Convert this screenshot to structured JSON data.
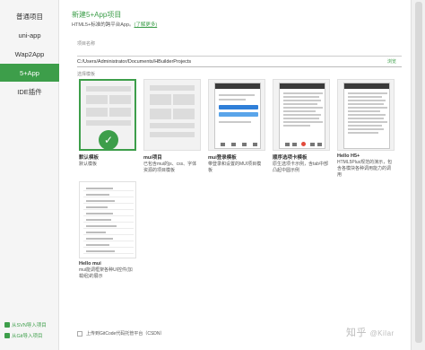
{
  "sidebar": {
    "items": [
      {
        "label": "普通项目"
      },
      {
        "label": "uni-app"
      },
      {
        "label": "Wap2App"
      },
      {
        "label": "5+App"
      },
      {
        "label": "IDE插件"
      }
    ],
    "active_index": 3,
    "footer": [
      {
        "label": "从SVN导入项目"
      },
      {
        "label": "从Git导入项目"
      }
    ]
  },
  "header": {
    "title": "新建5+App项目",
    "subtitle": "HTML5+标准的跨平台App。",
    "subtitle_link": "(了解更多)"
  },
  "form": {
    "name_label": "项目名称",
    "name_value": "",
    "path_value": "C:/Users/Administrator/Documents/HBuilderProjects",
    "browse_label": "浏览",
    "template_label": "选择模板"
  },
  "templates": [
    {
      "name": "默认模板",
      "desc": "默认模板",
      "selected": true
    },
    {
      "name": "mui项目",
      "desc": "已包含mui的js、css、字体资源的项目模板",
      "selected": false
    },
    {
      "name": "mui登录模板",
      "desc": "带登录和设置的MUI项目模板",
      "selected": false
    },
    {
      "name": "顺序选项卡模板",
      "desc": "原生选项卡示例，含tab中部凸起中圆示例",
      "selected": false
    },
    {
      "name": "Hello H5+",
      "desc": "HTML5Plus规范的演示，包含各模块各种调用能力的调用",
      "selected": false
    },
    {
      "name": "Hello mui",
      "desc": "mui能调框架各种UI控件(加载组)的展示",
      "selected": false
    }
  ],
  "bottom": {
    "checkbox_label": "上传到GitCode代码托管平台（CSDN）",
    "checked": false
  },
  "watermark": {
    "main": "知乎",
    "sub": "@Kilar"
  }
}
